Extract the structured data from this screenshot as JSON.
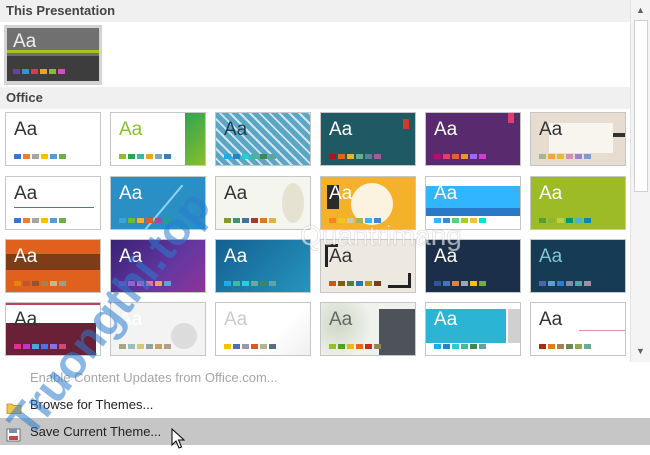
{
  "sections": {
    "current": "This Presentation",
    "office": "Office"
  },
  "menu": {
    "enable_updates": "Enable Content Updates from Office.com...",
    "browse": "Browse for Themes...",
    "save": "Save Current Theme..."
  },
  "thumb_label": "Aa",
  "watermark": {
    "left_text": "Truongthi.top",
    "right_text": "Quantrimang"
  },
  "scroll": {
    "up_icon": "triangle-up-icon",
    "down_icon": "triangle-down-icon"
  },
  "themes": [
    {
      "bg": "#ffffff",
      "fg": "#333333",
      "deco": ""
    },
    {
      "bg": "#ffffff",
      "fg": "#8bbf2c",
      "deco": "facet"
    },
    {
      "bg": "#5aa6c4",
      "fg": "#1d3d50",
      "deco": "pattern"
    },
    {
      "bg": "#1f5a64",
      "fg": "#ffffff",
      "deco": "ion"
    },
    {
      "bg": "#5a2a6e",
      "fg": "#ffffff",
      "deco": "ion-purple"
    },
    {
      "bg": "#e6ddd0",
      "fg": "#333333",
      "deco": "wood"
    },
    {
      "bg": "#ffffff",
      "fg": "#333333",
      "deco": "line"
    },
    {
      "bg": "#2a8fc4",
      "fg": "#ffffff",
      "deco": "wisp"
    },
    {
      "bg": "#f5f5f0",
      "fg": "#333333",
      "deco": "organic"
    },
    {
      "bg": "#f3b22a",
      "fg": "#ffffff",
      "deco": "circle"
    },
    {
      "bg": "#ffffff",
      "fg": "#ffffff",
      "deco": "blueband"
    },
    {
      "bg": "#9dbb26",
      "fg": "#ffffff",
      "deco": ""
    },
    {
      "bg": "#e0611d",
      "fg": "#ffffff",
      "deco": "darkband"
    },
    {
      "bg": "#4b2b8a",
      "fg": "#ffffff",
      "deco": "mesh"
    },
    {
      "bg": "#1e7ba8",
      "fg": "#ffffff",
      "deco": "mesh2"
    },
    {
      "bg": "#ede9e1",
      "fg": "#333333",
      "deco": "frame"
    },
    {
      "bg": "#1b2f4a",
      "fg": "#ffffff",
      "deco": ""
    },
    {
      "bg": "#163c55",
      "fg": "#7fc4d8",
      "deco": ""
    },
    {
      "bg": "#ffffff",
      "fg": "#333333",
      "deco": "berry"
    },
    {
      "bg": "#f3f3f3",
      "fg": "#ffffff",
      "deco": "drops"
    },
    {
      "bg": "#ffffff",
      "fg": "#cccccc",
      "deco": "slice"
    },
    {
      "bg": "#f0f2ee",
      "fg": "#666666",
      "deco": "leaves"
    },
    {
      "bg": "#ffffff",
      "fg": "#ffffff",
      "deco": "cyanblock"
    },
    {
      "bg": "#ffffff",
      "fg": "#333333",
      "deco": "pinkline"
    }
  ],
  "swatches": [
    [
      "#4472c4",
      "#ed7d31",
      "#a5a5a5",
      "#ffc000",
      "#5b9bd5",
      "#70ad47"
    ],
    [
      "#8bbf2c",
      "#2fa44f",
      "#42b3ae",
      "#e9a332",
      "#7aa4c9",
      "#3d7eb7"
    ],
    [
      "#1cade4",
      "#2683c6",
      "#27ced7",
      "#42ba97",
      "#3e8853",
      "#62a39f"
    ],
    [
      "#b01513",
      "#ea6312",
      "#e6b729",
      "#6bab90",
      "#55839a",
      "#9e5e9b"
    ],
    [
      "#b31166",
      "#e33d6f",
      "#e45f3c",
      "#e9943a",
      "#9b6bf2",
      "#d53dd0"
    ],
    [
      "#a5b592",
      "#f3a447",
      "#e7bc29",
      "#d092a7",
      "#9c85c0",
      "#809ec2"
    ],
    [
      "#4472c4",
      "#ed7d31",
      "#a5a5a5",
      "#ffc000",
      "#5b9bd5",
      "#70ad47"
    ],
    [
      "#38a7d7",
      "#6fb93f",
      "#f3b22a",
      "#e05d23",
      "#ae4698",
      "#2d9c8f"
    ],
    [
      "#83992a",
      "#3c9770",
      "#44709d",
      "#a23c33",
      "#d97828",
      "#deb340"
    ],
    [
      "#ff8021",
      "#f0c524",
      "#c8c8b8",
      "#a7b25c",
      "#31b6fd",
      "#4584d3"
    ],
    [
      "#31b6fd",
      "#4584d3",
      "#5bd078",
      "#a5d028",
      "#f5c040",
      "#05e0db"
    ],
    [
      "#549e39",
      "#8ab833",
      "#c0cf3a",
      "#029676",
      "#4ab5c4",
      "#0989b1"
    ],
    [
      "#e48312",
      "#bd582c",
      "#865640",
      "#9b8357",
      "#c2bc80",
      "#94a088"
    ],
    [
      "#6b4cbc",
      "#8d62d1",
      "#c067c8",
      "#e0788e",
      "#f19f5a",
      "#5ca3d8"
    ],
    [
      "#1cade4",
      "#42ba97",
      "#27ced7",
      "#6bab90",
      "#3e8853",
      "#62a39f"
    ],
    [
      "#c55a11",
      "#7f6000",
      "#548235",
      "#2e75b6",
      "#bf9000",
      "#843c0c"
    ],
    [
      "#2f5597",
      "#4472c4",
      "#ed7d31",
      "#a5a5a5",
      "#ffc000",
      "#70ad47"
    ],
    [
      "#4a66ac",
      "#629dd1",
      "#297fd5",
      "#7f8fa9",
      "#5aa2ae",
      "#9d90a0"
    ],
    [
      "#e32d91",
      "#c830cc",
      "#4ea6dc",
      "#4775e7",
      "#8971e1",
      "#d54773"
    ],
    [
      "#a9a57c",
      "#9cbebd",
      "#d2cb6c",
      "#95a39d",
      "#c89f5d",
      "#b1a089"
    ],
    [
      "#f5c201",
      "#526db0",
      "#989aac",
      "#dc5924",
      "#b4b392",
      "#5d6b84"
    ],
    [
      "#90c226",
      "#54a021",
      "#e6b91e",
      "#e76618",
      "#c42f1a",
      "#918655"
    ],
    [
      "#1cade4",
      "#2683c6",
      "#27ced7",
      "#42ba97",
      "#3e8853",
      "#62a39f"
    ],
    [
      "#a53010",
      "#de7e18",
      "#9f8351",
      "#728653",
      "#92aa4c",
      "#6aac91"
    ]
  ]
}
